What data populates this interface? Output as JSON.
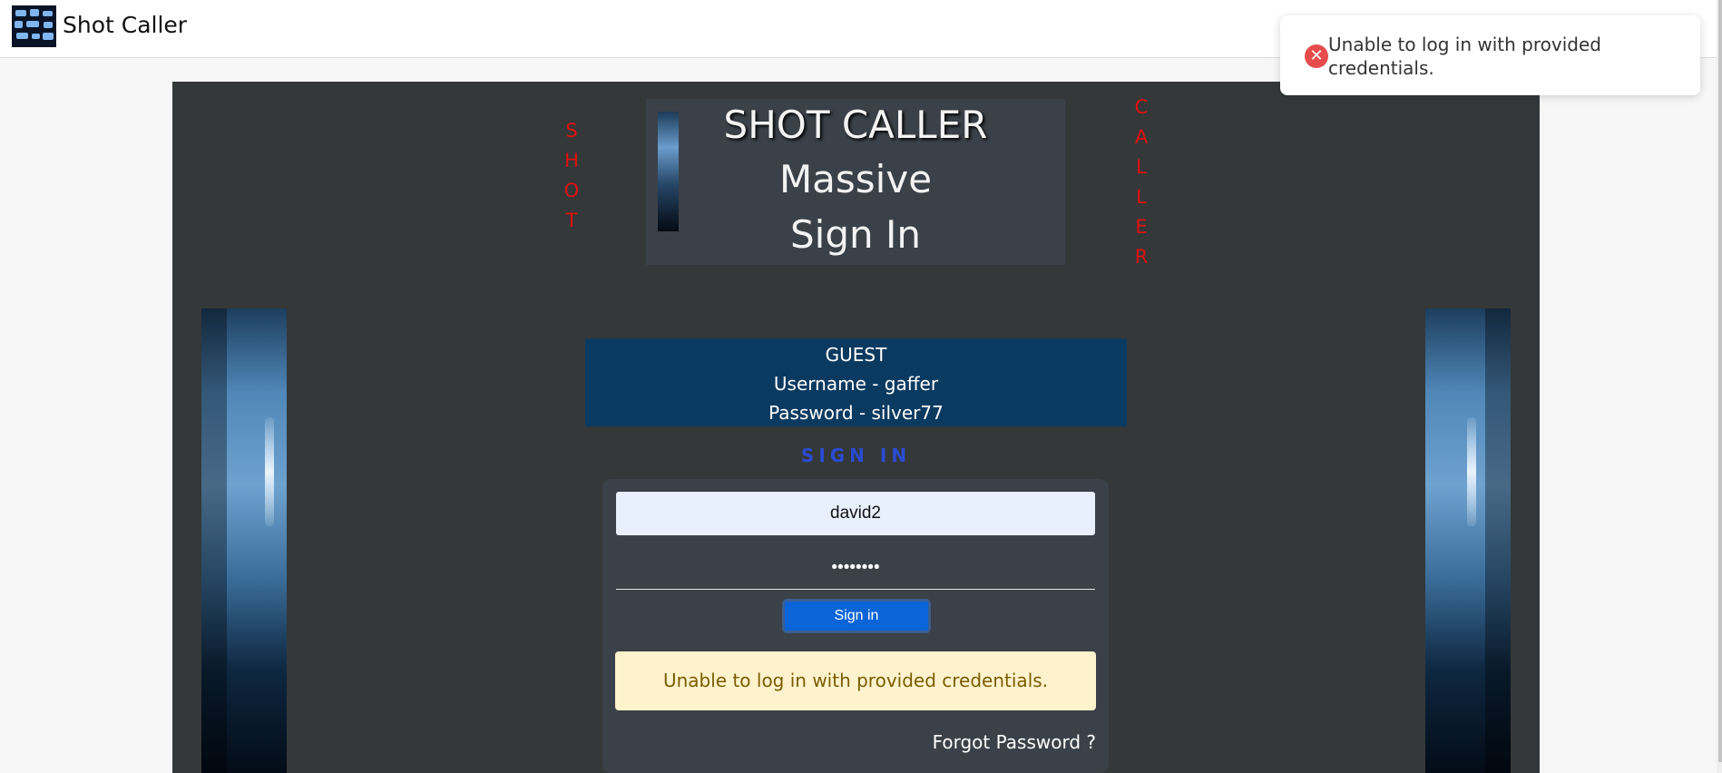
{
  "app": {
    "name": "Shot Caller"
  },
  "toast": {
    "message": "Unable to log in with provided credentials.",
    "type": "error",
    "icon": "error-x-icon"
  },
  "vertical": {
    "left": [
      "S",
      "H",
      "O",
      "T"
    ],
    "right": [
      "C",
      "A",
      "L",
      "L",
      "E",
      "R"
    ]
  },
  "header": {
    "title": "SHOT CALLER",
    "subtitle": "Massive",
    "heading": "Sign In"
  },
  "guest": {
    "label": "GUEST",
    "username": "Username - gaffer",
    "password": "Password - silver77"
  },
  "signin": {
    "heading": "SIGN IN",
    "username_value": "david2",
    "password_value": "••••••••",
    "button": "Sign in",
    "error": "Unable to log in with provided credentials.",
    "forgot": "Forgot Password ?"
  },
  "colors": {
    "panel": "#343839",
    "accent_red": "#e01010",
    "primary_button": "#0b64d8",
    "guest_bg": "#0b3a60"
  }
}
